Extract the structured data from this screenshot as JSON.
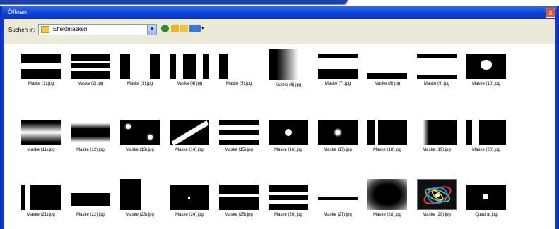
{
  "window": {
    "title": "Öffnen",
    "close_label": "x"
  },
  "toolbar": {
    "look_in_label": "Suchen in:",
    "folder_icon": "folder-icon",
    "look_in_value": "Effektmasken",
    "combo_arrow": "▾",
    "views_caret": "▾"
  },
  "files": [
    {
      "name": "Maske (1).jpg"
    },
    {
      "name": "Maske (2).jpg"
    },
    {
      "name": "Maske (3).jpg"
    },
    {
      "name": "Maske (4).jpg"
    },
    {
      "name": "Maske (5).jpg"
    },
    {
      "name": "Maske (6).jpg"
    },
    {
      "name": "Maske (7).jpg"
    },
    {
      "name": "Maske (8).jpg"
    },
    {
      "name": "Maske (9).jpg"
    },
    {
      "name": "Maske (10).jpg"
    },
    {
      "name": "Maske (11).jpg"
    },
    {
      "name": "Maske (12).jpg"
    },
    {
      "name": "Maske (13).jpg"
    },
    {
      "name": "Maske (14).jpg"
    },
    {
      "name": "Maske (15).jpg"
    },
    {
      "name": "Maske (16).jpg"
    },
    {
      "name": "Maske (17).jpg"
    },
    {
      "name": "Maske (18).jpg"
    },
    {
      "name": "Maske (19).jpg"
    },
    {
      "name": "Maske (20).jpg"
    },
    {
      "name": "Maske (21).jpg"
    },
    {
      "name": "Maske (22).jpg"
    },
    {
      "name": "Maske (23).jpg"
    },
    {
      "name": "Maske (24).jpg"
    },
    {
      "name": "Maske (25).jpg"
    },
    {
      "name": "Maske (26).jpg"
    },
    {
      "name": "Maske (27).jpg"
    },
    {
      "name": "Maske (28).jpg"
    },
    {
      "name": "Maske (29).jpg"
    },
    {
      "name": "Quadrat.jpg"
    }
  ]
}
